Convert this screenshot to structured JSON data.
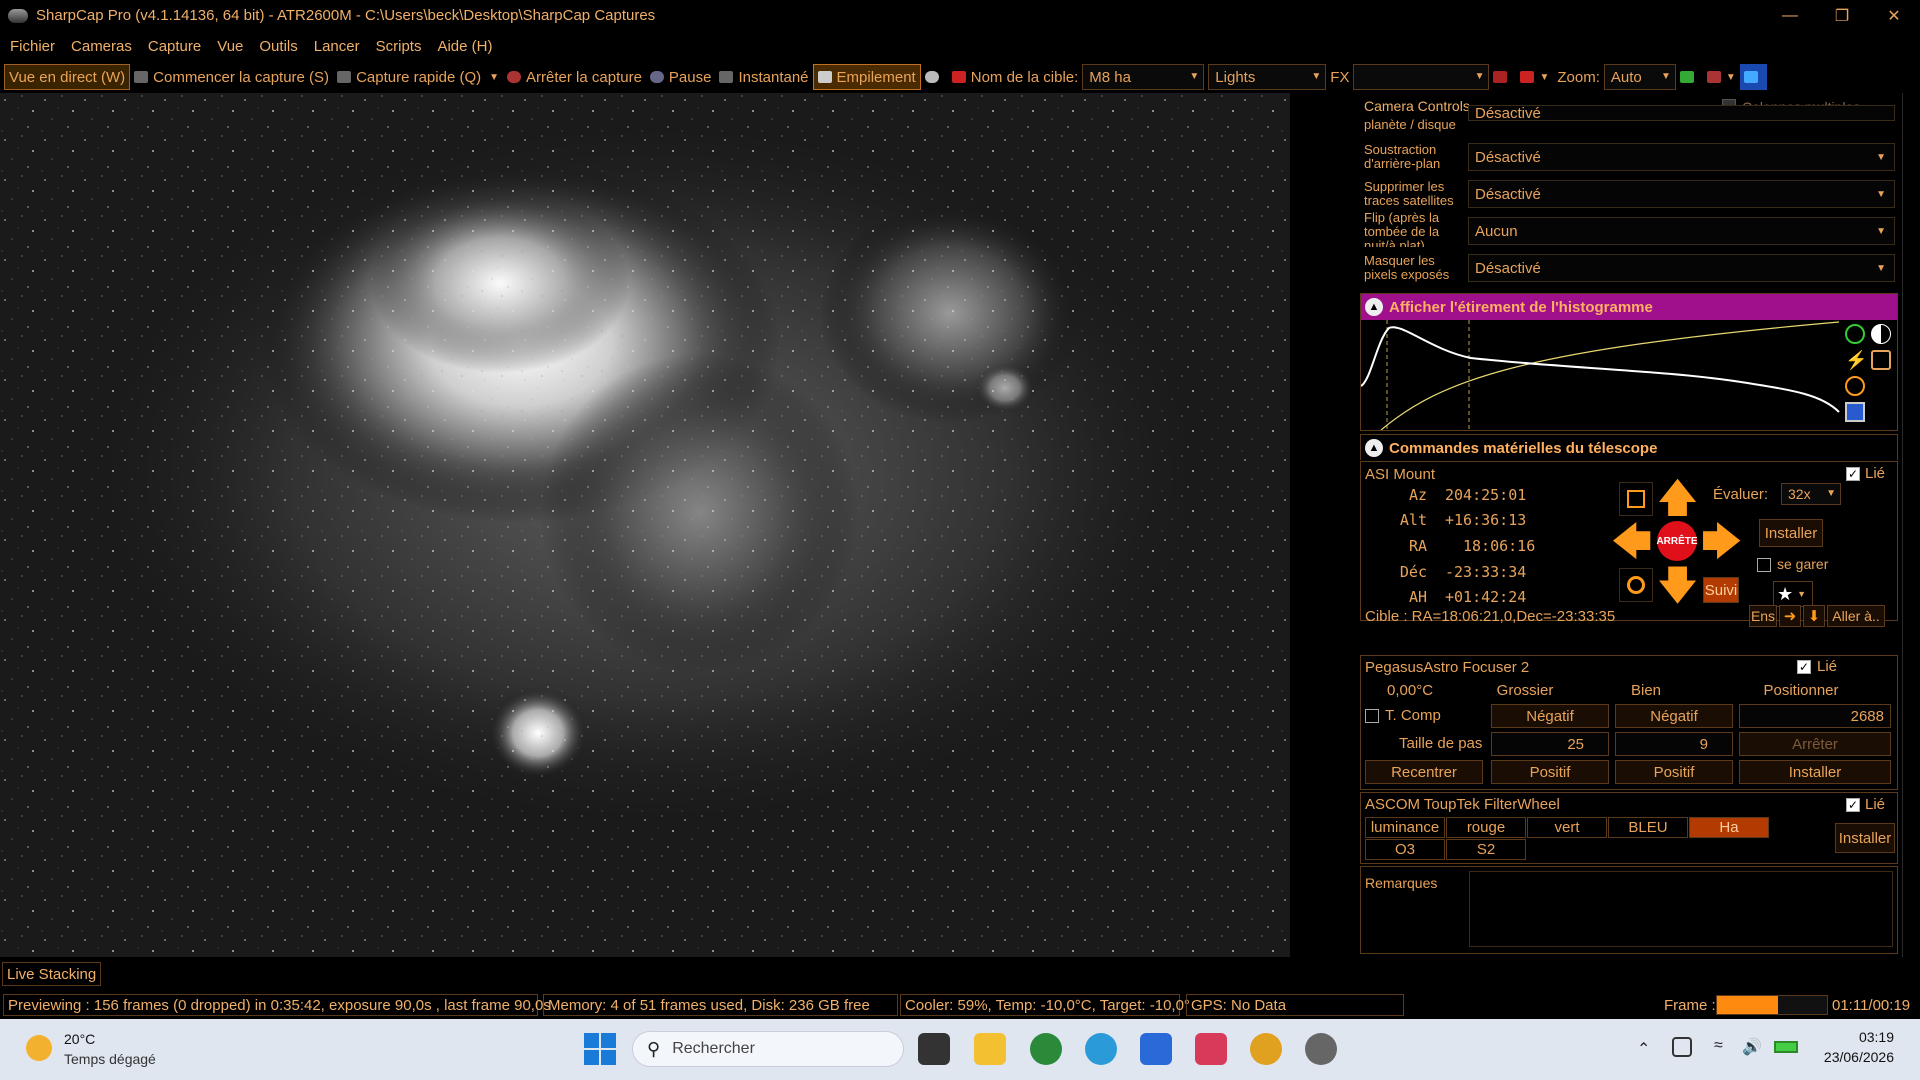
{
  "window": {
    "title": "SharpCap Pro (v4.1.14136, 64 bit) - ATR2600M - C:\\Users\\beck\\Desktop\\SharpCap Captures"
  },
  "menu": [
    "Fichier",
    "Cameras",
    "Capture",
    "Vue",
    "Outils",
    "Lancer",
    "Scripts",
    "Aide (H)"
  ],
  "toolbar": {
    "live_view": "Vue en direct (W)",
    "start_capture": "Commencer la capture (S)",
    "quick_capture": "Capture rapide (Q)",
    "stop_capture": "Arrêter la capture",
    "pause": "Pause",
    "snapshot": "Instantané",
    "stacking": "Empilement",
    "target_label": "Nom de la cible:",
    "target_value": "M8 ha",
    "frame_type": "Lights",
    "fx_label": "FX",
    "zoom_label": "Zoom:",
    "zoom_value": "Auto"
  },
  "panel": {
    "header": "Camera Controls",
    "multi_columns": "Colonnes multiples",
    "rows": [
      {
        "label": "planète / disque",
        "value": "Désactivé"
      },
      {
        "label": "Soustraction d'arrière-plan",
        "value": "Désactivé"
      },
      {
        "label": "Supprimer les traces satellites",
        "value": "Désactivé"
      },
      {
        "label": "Flip (après la tombée de la nuit/à plat)",
        "value": "Aucun"
      },
      {
        "label": "Masquer les pixels exposés",
        "value": "Désactivé"
      }
    ],
    "histogram_title": "Afficher l'étirement de l'histogramme",
    "telescope_title": "Commandes matérielles du télescope",
    "mount": {
      "name": "ASI Mount",
      "linked": "Lié",
      "az_label": "Az",
      "az": "204:25:01",
      "alt_label": "Alt",
      "alt": "+16:36:13",
      "ra_label": "RA",
      "ra": "18:06:16",
      "dec_label": "Déc",
      "dec": "-23:33:34",
      "ah_label": "AH",
      "ah": "+01:42:24",
      "stop": "ARRÊTE",
      "rate_label": "Évaluer:",
      "rate": "32x",
      "install": "Installer",
      "park": "se garer",
      "track": "Suivi",
      "target": "Cible : RA=18:06:21,0,Dec=-23:33:35",
      "set": "Ens",
      "goto": "Aller à.."
    },
    "focuser": {
      "name": "PegasusAstro Focuser 2",
      "linked": "Lié",
      "temp": "0,00°C",
      "coarse": "Grossier",
      "fine": "Bien",
      "position_label": "Positionner",
      "tcomp": "T. Comp",
      "neg1": "Négatif",
      "neg2": "Négatif",
      "position": "2688",
      "step_label": "Taille de pas",
      "step_coarse": "25",
      "step_fine": "9",
      "stop": "Arrêter",
      "recenter": "Recentrer",
      "pos1": "Positif",
      "pos2": "Positif",
      "install": "Installer"
    },
    "filterwheel": {
      "name": "ASCOM ToupTek FilterWheel",
      "linked": "Lié",
      "filters": [
        "luminance",
        "rouge",
        "vert",
        "BLEU",
        "Ha",
        "O3",
        "S2"
      ],
      "active": "Ha",
      "install": "Installer"
    },
    "notes_label": "Remarques"
  },
  "bottom": {
    "live_stacking_tab": "Live Stacking",
    "preview": "Previewing : 156 frames (0 dropped) in 0:35:42, exposure 90,0s , last frame 90,0s",
    "memory": "Memory: 4 of 51 frames used, Disk: 236 GB free",
    "cooler": "Cooler: 59%, Temp: -10,0°C, Target: -10,0°",
    "gps": "GPS: No Data",
    "frame_label": "Frame :",
    "frame_progress": 0.55,
    "frame_time": "01:11/00:19"
  },
  "taskbar": {
    "temp": "20°C",
    "weather": "Temps dégagé",
    "search": "Rechercher",
    "time": "03:19",
    "date": "23/06/2026"
  },
  "colors": {
    "accent": "#e8a35a",
    "histogram_bar": "#a0108c",
    "active_filter": "#b33a00",
    "arrow": "#ff9a1a",
    "stop": "#e0101a"
  }
}
